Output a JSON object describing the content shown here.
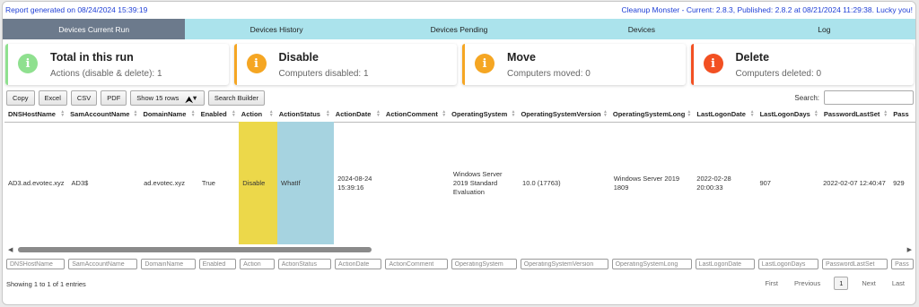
{
  "header": {
    "left": "Report generated on 08/24/2024 15:39:19",
    "right": "Cleanup Monster - Current: 2.8.3, Published: 2.8.2 at 08/21/2024 11:29:38. Lucky you!"
  },
  "tabs": [
    {
      "label": "Devices Current Run",
      "active": true
    },
    {
      "label": "Devices History"
    },
    {
      "label": "Devices Pending"
    },
    {
      "label": "Devices"
    },
    {
      "label": "Log"
    }
  ],
  "cards": [
    {
      "title": "Total in this run",
      "text": "Actions (disable & delete): 1",
      "color": "#8fe08f",
      "icon": "info-icon"
    },
    {
      "title": "Disable",
      "text": "Computers disabled: 1",
      "color": "#f5a623",
      "icon": "info-icon"
    },
    {
      "title": "Move",
      "text": "Computers moved: 0",
      "color": "#f5a623",
      "icon": "info-icon"
    },
    {
      "title": "Delete",
      "text": "Computers deleted: 0",
      "color": "#f25022",
      "icon": "info-icon"
    }
  ],
  "toolbar": {
    "copy": "Copy",
    "excel": "Excel",
    "csv": "CSV",
    "pdf": "PDF",
    "show_rows": "Show 15 rows",
    "show_rows_arrow": "▼",
    "search_builder": "Search Builder"
  },
  "search": {
    "label": "Search:",
    "value": ""
  },
  "columns": [
    "DNSHostName",
    "SamAccountName",
    "DomainName",
    "Enabled",
    "Action",
    "ActionStatus",
    "ActionDate",
    "ActionComment",
    "OperatingSystem",
    "OperatingSystemVersion",
    "OperatingSystemLong",
    "LastLogonDate",
    "LastLogonDays",
    "PasswordLastSet",
    "Pass"
  ],
  "row": [
    "AD3.ad.evotec.xyz",
    "AD3$",
    "ad.evotec.xyz",
    "True",
    "Disable",
    "WhatIf",
    "2024-08-24 15:39:16",
    "",
    "Windows Server 2019 Standard Evaluation",
    "10.0 (17763)",
    "Windows Server 2019 1809",
    "2022-02-28 20:00:33",
    "907",
    "2022-02-07 12:40:47",
    "929"
  ],
  "row_colors": {
    "action": "#ecd84a",
    "action_status": "#a6d3e0"
  },
  "filters": [
    "DNSHostName",
    "SamAccountName",
    "DomainName",
    "Enabled",
    "Action",
    "ActionStatus",
    "ActionDate",
    "ActionComment",
    "OperatingSystem",
    "OperatingSystemVersion",
    "OperatingSystemLong",
    "LastLogonDate",
    "LastLogonDays",
    "PasswordLastSet",
    "Pass"
  ],
  "info": "Showing 1 to 1 of 1 entries",
  "pager": {
    "first": "First",
    "previous": "Previous",
    "current": "1",
    "next": "Next",
    "last": "Last"
  },
  "scroll": {
    "left_arrow": "◀",
    "right_arrow": "▶"
  }
}
